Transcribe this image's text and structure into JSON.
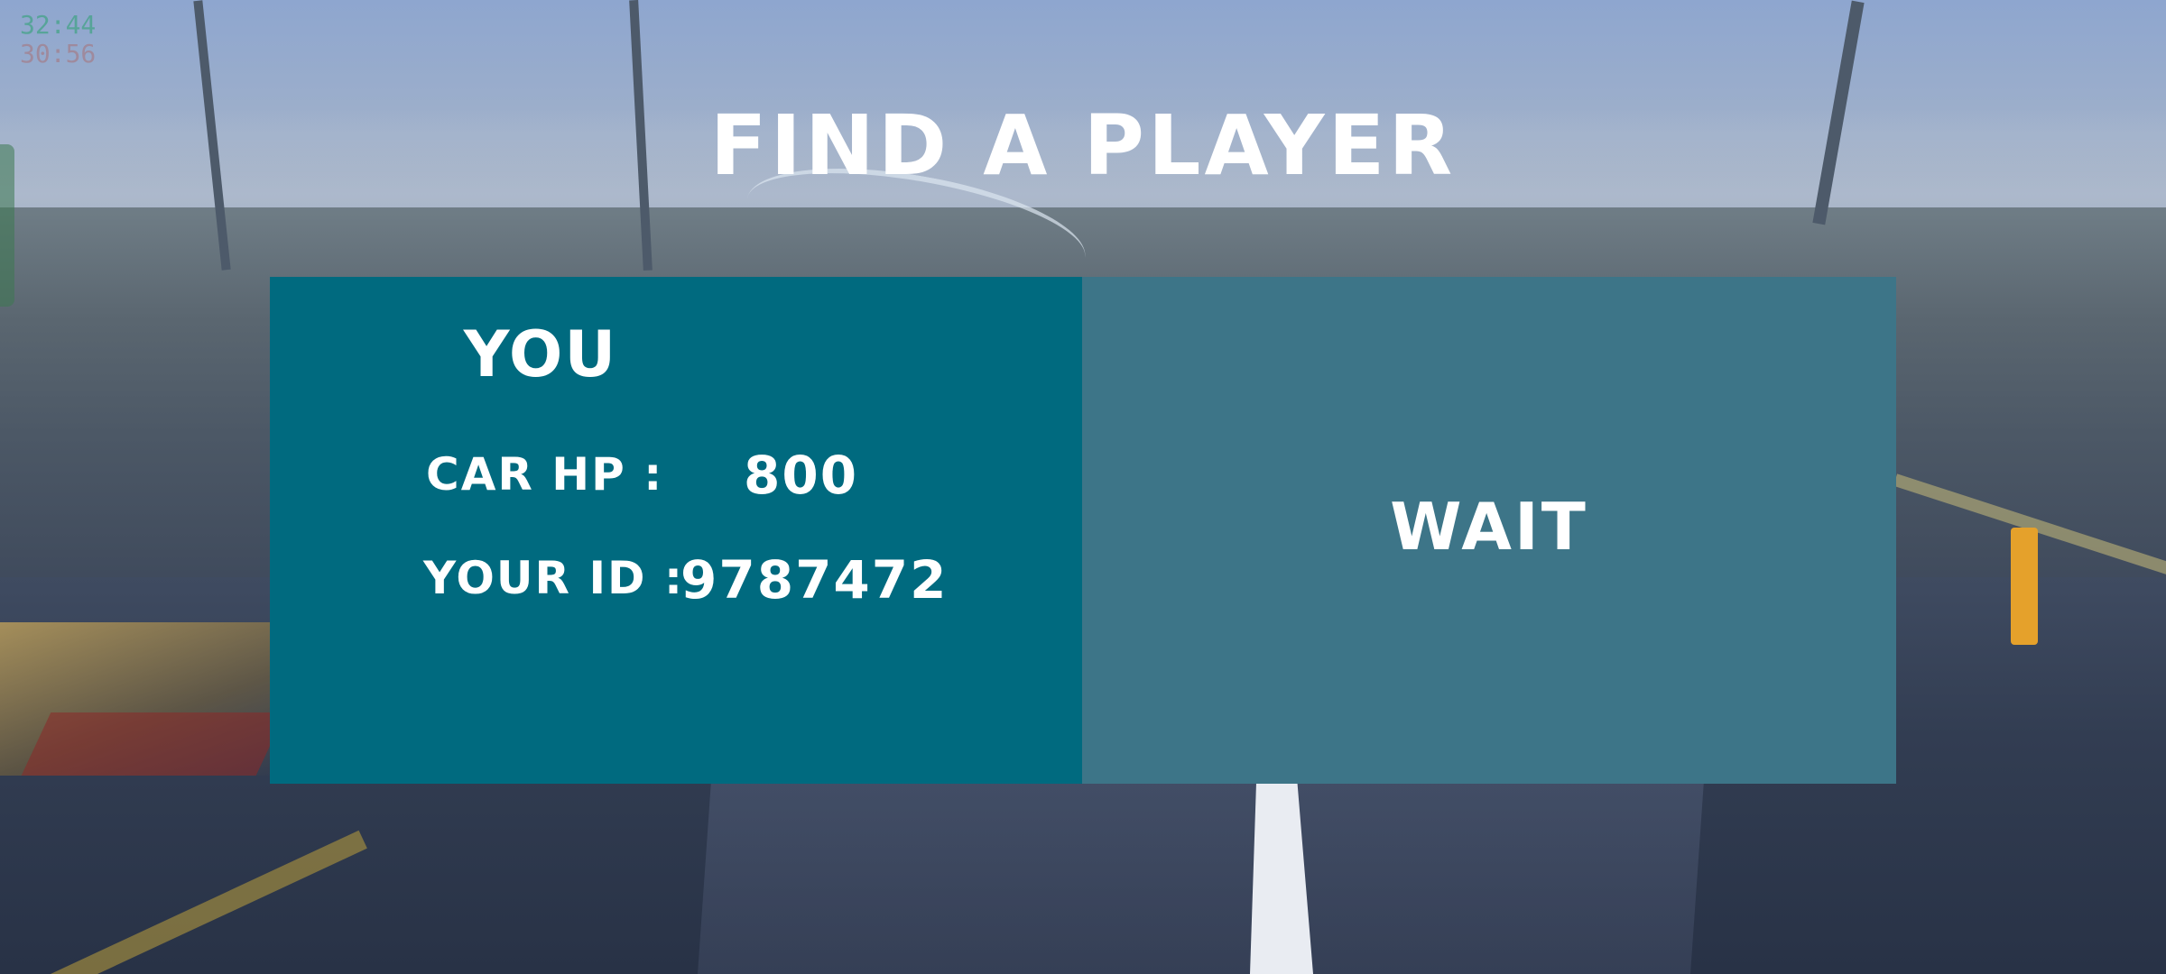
{
  "header": {
    "title": "FIND A PLAYER"
  },
  "hud": {
    "time_primary": "32:44",
    "time_secondary": "30:56"
  },
  "player_panel": {
    "heading": "YOU",
    "car_hp_label": "CAR HP :",
    "car_hp_value": "800",
    "id_label": "YOUR ID :",
    "id_value": "9787472"
  },
  "opponent_panel": {
    "status": "WAIT"
  },
  "colors": {
    "player_panel_bg": "#006a7f",
    "opponent_panel_bg": "#3d7588",
    "text": "#ffffff"
  }
}
